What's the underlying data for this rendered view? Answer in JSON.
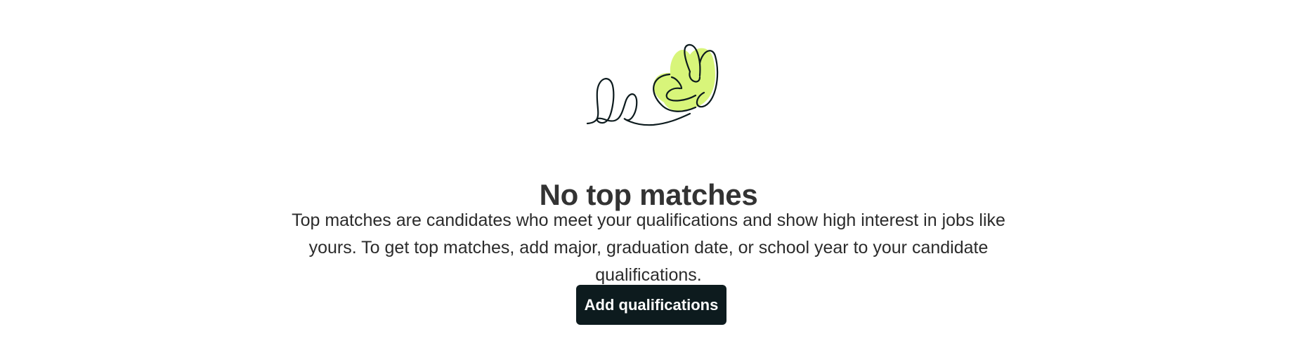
{
  "empty_state": {
    "illustration_icon": "scribble-flower-icon",
    "title": "No top matches",
    "description": "Top matches are candidates who meet your qualifications and show high interest in jobs like yours. To get top matches, add major, graduation date, or school year to your candidate qualifications.",
    "button_label": "Add qualifications"
  },
  "colors": {
    "accent_fill": "#d8f57a",
    "stroke": "#0d1b1e",
    "button_bg": "#0d1b1e",
    "title_text": "#333333"
  }
}
